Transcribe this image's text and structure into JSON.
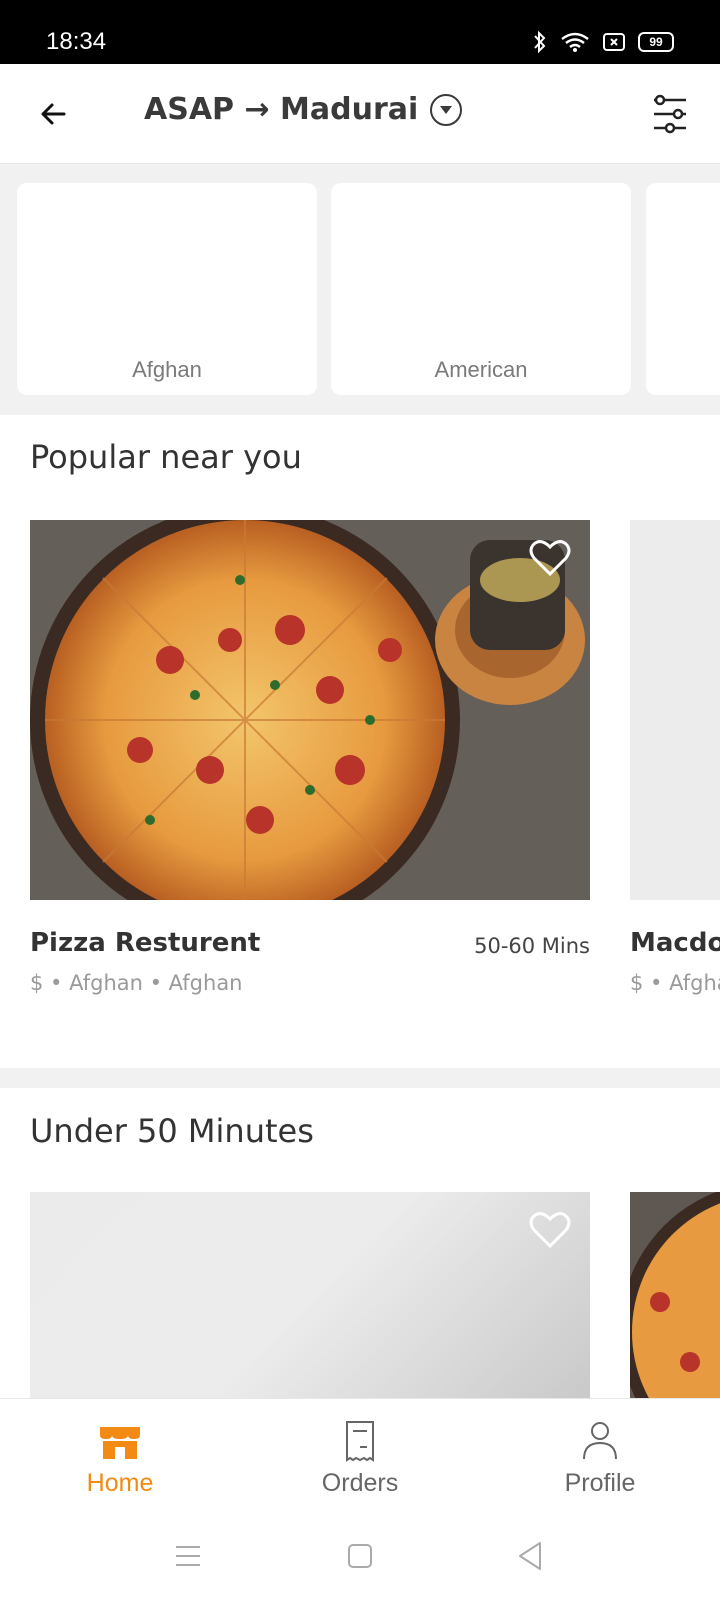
{
  "status_bar": {
    "time": "18:34",
    "battery": "99"
  },
  "header": {
    "title": "ASAP → Madurai"
  },
  "categories": [
    {
      "label": "Afghan"
    },
    {
      "label": "American"
    }
  ],
  "popular": {
    "title": "Popular near you",
    "cards": [
      {
        "name": "Pizza Resturent",
        "time": "50-60 Mins",
        "meta": "$ • Afghan • Afghan"
      },
      {
        "name": "Macdonalds",
        "meta": "$ • Afghan"
      }
    ]
  },
  "under50": {
    "title": "Under 50 Minutes"
  },
  "bottom_nav": {
    "home": "Home",
    "orders": "Orders",
    "profile": "Profile"
  },
  "colors": {
    "accent": "#f28a14",
    "inactive": "#666666"
  }
}
